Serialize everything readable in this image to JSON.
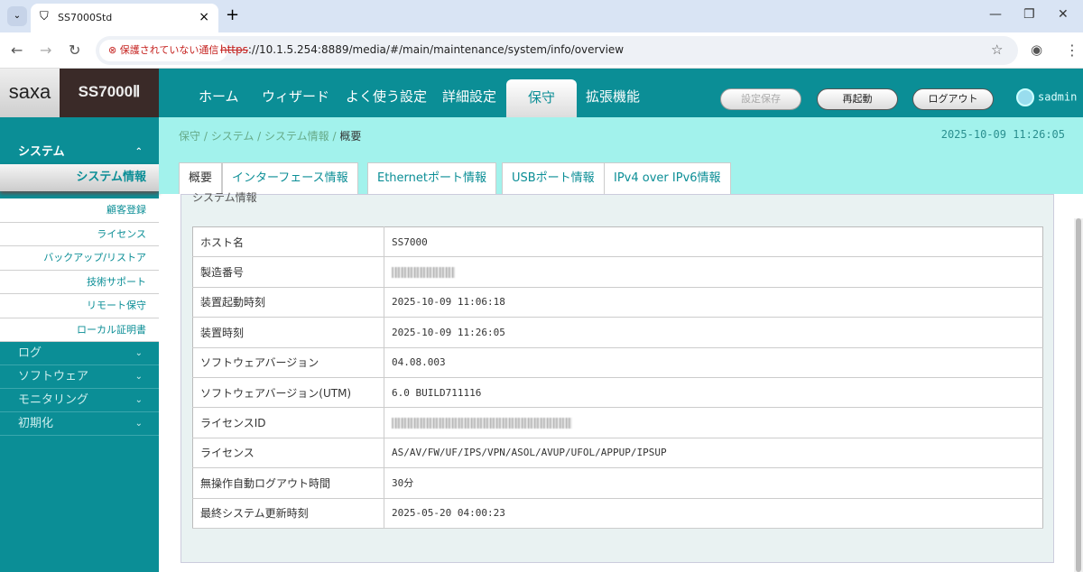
{
  "browser": {
    "tab_title": "SS7000Std",
    "security_label": "保護されていない通信",
    "url_scheme": "https",
    "url_rest": "://10.1.5.254:8889/media/#/main/maintenance/system/info/overview"
  },
  "header": {
    "logo_brand": "saxa",
    "logo_product": "SS7000Ⅱ",
    "nav": [
      "ホーム",
      "ウィザード",
      "よく使う設定",
      "詳細設定",
      "保守",
      "拡張機能"
    ],
    "buttons": {
      "save": "設定保存",
      "reboot": "再起動",
      "logout": "ログアウト"
    },
    "user": "sadmin"
  },
  "sidebar": {
    "group": "システム",
    "active": "システム情報",
    "sub": [
      "顧客登録",
      "ライセンス",
      "バックアップ/リストア",
      "技術サポート",
      "リモート保守",
      "ローカル証明書"
    ],
    "groups": [
      "ログ",
      "ソフトウェア",
      "モニタリング",
      "初期化"
    ]
  },
  "breadcrumb": [
    "保守",
    "システム",
    "システム情報",
    "概要"
  ],
  "datetime": "2025-10-09 11:26:05",
  "tabs": [
    "概要",
    "インターフェース情報",
    "Ethernetポート情報",
    "USBポート情報",
    "IPv4 over IPv6情報"
  ],
  "panel": {
    "title": "システム情報",
    "rows": [
      {
        "k": "ホスト名",
        "v": "SS7000"
      },
      {
        "k": "製造番号",
        "v": ""
      },
      {
        "k": "装置起動時刻",
        "v": "2025-10-09 11:06:18"
      },
      {
        "k": "装置時刻",
        "v": "2025-10-09 11:26:05"
      },
      {
        "k": "ソフトウェアバージョン",
        "v": "04.08.003"
      },
      {
        "k": "ソフトウェアバージョン(UTM)",
        "v": "6.0 BUILD711116"
      },
      {
        "k": "ライセンスID",
        "v": ""
      },
      {
        "k": "ライセンス",
        "v": "AS/AV/FW/UF/IPS/VPN/ASOL/AVUP/UFOL/APPUP/IPSUP"
      },
      {
        "k": "無操作自動ログアウト時間",
        "v": "30分"
      },
      {
        "k": "最終システム更新時刻",
        "v": "2025-05-20 04:00:23"
      }
    ]
  }
}
